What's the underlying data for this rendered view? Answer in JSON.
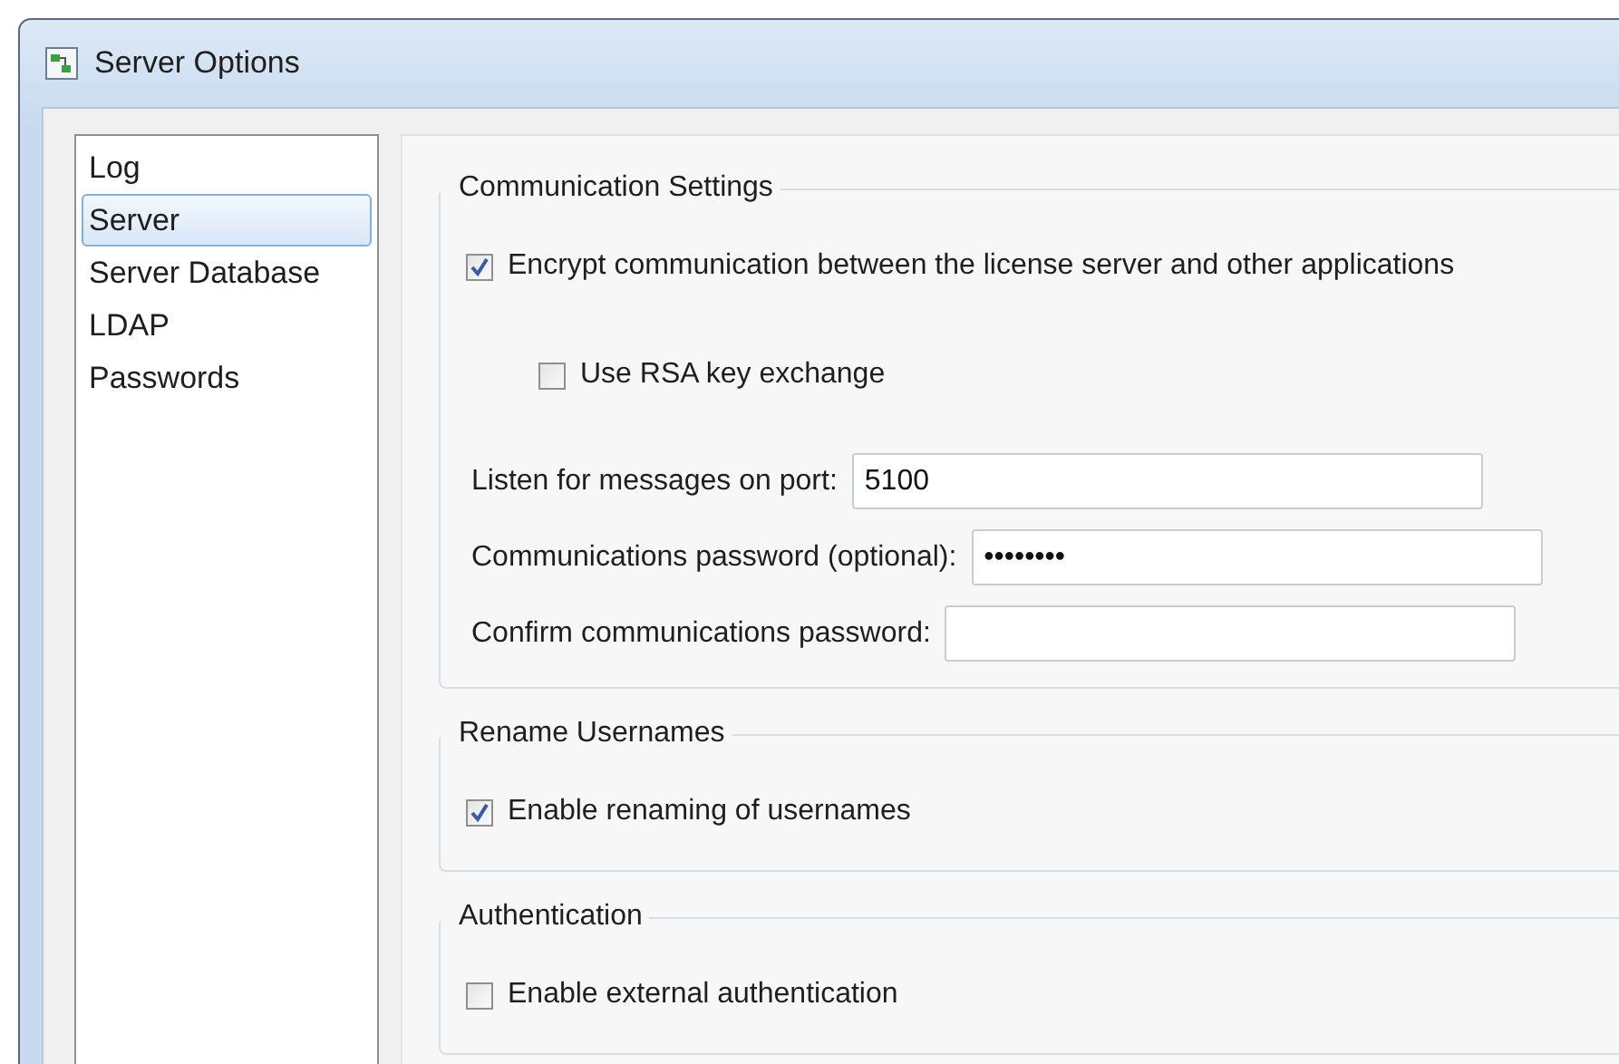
{
  "window": {
    "title": "Server Options"
  },
  "sidebar": {
    "items": [
      {
        "label": "Log",
        "selected": false
      },
      {
        "label": "Server",
        "selected": true
      },
      {
        "label": "Server Database",
        "selected": false
      },
      {
        "label": "LDAP",
        "selected": false
      },
      {
        "label": "Passwords",
        "selected": false
      }
    ]
  },
  "groups": [
    {
      "title": "Communication Settings",
      "checkboxes": [
        {
          "label": "Encrypt communication between the license server and other applications",
          "checked": true,
          "children": [
            {
              "label": "Use RSA key exchange",
              "checked": false
            }
          ]
        }
      ],
      "fields": [
        {
          "label": "Listen for messages on port:",
          "value": "5100"
        },
        {
          "label": "Communications password (optional):",
          "value": "••••••••"
        },
        {
          "label": "Confirm communications password:"
        }
      ]
    },
    {
      "title": "Rename Usernames",
      "checkboxes": [
        {
          "label": "Enable renaming of usernames",
          "checked": true
        }
      ]
    },
    {
      "title": "Authentication",
      "checkboxes": [
        {
          "label": "Enable external authentication",
          "checked": false
        }
      ]
    }
  ]
}
